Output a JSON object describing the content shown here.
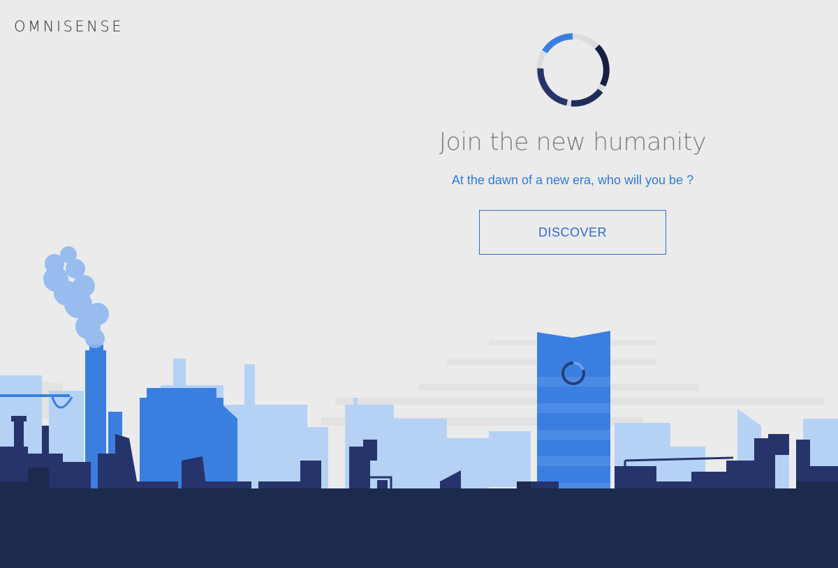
{
  "brand": {
    "name": "OMNISENSE"
  },
  "hero": {
    "headline": "Join the new humanity",
    "subline": "At the dawn of a new era, who will you be ?",
    "cta_label": "DISCOVER"
  },
  "colors": {
    "background": "#ebebeb",
    "accent_blue": "#2f7ad9",
    "light_blue": "#b5d2f5",
    "mid_blue": "#3a7fe0",
    "navy": "#27336b",
    "dark_navy": "#1b2a4d"
  },
  "icons": [
    "loader-ring-icon",
    "tower-loader-icon",
    "smoke-icon"
  ]
}
